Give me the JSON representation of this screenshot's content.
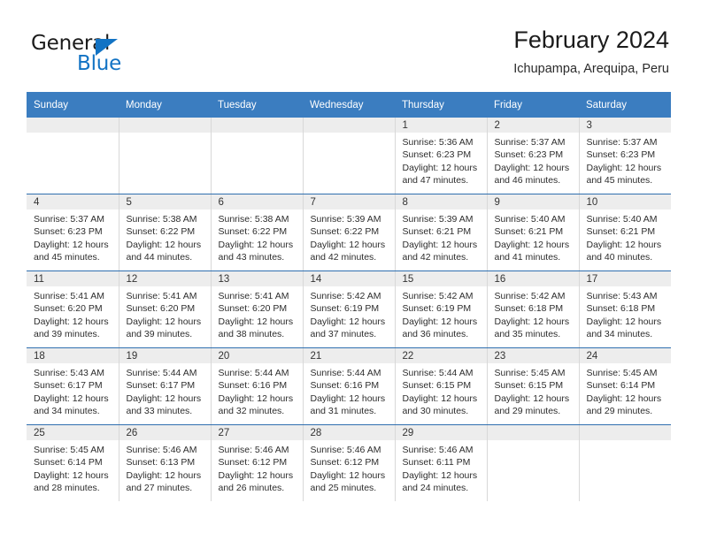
{
  "brand": {
    "name_top": "General",
    "name_bottom": "Blue",
    "accent_color": "#1273c4"
  },
  "header": {
    "title": "February 2024",
    "subtitle": "Ichupampa, Arequipa, Peru"
  },
  "calendar": {
    "header_bg": "#3b7dc0",
    "daynum_bg": "#ededed",
    "weekday_headers": [
      "Sunday",
      "Monday",
      "Tuesday",
      "Wednesday",
      "Thursday",
      "Friday",
      "Saturday"
    ],
    "labels": {
      "sunrise": "Sunrise:",
      "sunset": "Sunset:",
      "daylight": "Daylight:"
    },
    "weeks": [
      [
        {
          "day": "",
          "empty": true
        },
        {
          "day": "",
          "empty": true
        },
        {
          "day": "",
          "empty": true
        },
        {
          "day": "",
          "empty": true
        },
        {
          "day": "1",
          "sunrise": "Sunrise: 5:36 AM",
          "sunset": "Sunset: 6:23 PM",
          "daylight": "Daylight: 12 hours and 47 minutes."
        },
        {
          "day": "2",
          "sunrise": "Sunrise: 5:37 AM",
          "sunset": "Sunset: 6:23 PM",
          "daylight": "Daylight: 12 hours and 46 minutes."
        },
        {
          "day": "3",
          "sunrise": "Sunrise: 5:37 AM",
          "sunset": "Sunset: 6:23 PM",
          "daylight": "Daylight: 12 hours and 45 minutes."
        }
      ],
      [
        {
          "day": "4",
          "sunrise": "Sunrise: 5:37 AM",
          "sunset": "Sunset: 6:23 PM",
          "daylight": "Daylight: 12 hours and 45 minutes."
        },
        {
          "day": "5",
          "sunrise": "Sunrise: 5:38 AM",
          "sunset": "Sunset: 6:22 PM",
          "daylight": "Daylight: 12 hours and 44 minutes."
        },
        {
          "day": "6",
          "sunrise": "Sunrise: 5:38 AM",
          "sunset": "Sunset: 6:22 PM",
          "daylight": "Daylight: 12 hours and 43 minutes."
        },
        {
          "day": "7",
          "sunrise": "Sunrise: 5:39 AM",
          "sunset": "Sunset: 6:22 PM",
          "daylight": "Daylight: 12 hours and 42 minutes."
        },
        {
          "day": "8",
          "sunrise": "Sunrise: 5:39 AM",
          "sunset": "Sunset: 6:21 PM",
          "daylight": "Daylight: 12 hours and 42 minutes."
        },
        {
          "day": "9",
          "sunrise": "Sunrise: 5:40 AM",
          "sunset": "Sunset: 6:21 PM",
          "daylight": "Daylight: 12 hours and 41 minutes."
        },
        {
          "day": "10",
          "sunrise": "Sunrise: 5:40 AM",
          "sunset": "Sunset: 6:21 PM",
          "daylight": "Daylight: 12 hours and 40 minutes."
        }
      ],
      [
        {
          "day": "11",
          "sunrise": "Sunrise: 5:41 AM",
          "sunset": "Sunset: 6:20 PM",
          "daylight": "Daylight: 12 hours and 39 minutes."
        },
        {
          "day": "12",
          "sunrise": "Sunrise: 5:41 AM",
          "sunset": "Sunset: 6:20 PM",
          "daylight": "Daylight: 12 hours and 39 minutes."
        },
        {
          "day": "13",
          "sunrise": "Sunrise: 5:41 AM",
          "sunset": "Sunset: 6:20 PM",
          "daylight": "Daylight: 12 hours and 38 minutes."
        },
        {
          "day": "14",
          "sunrise": "Sunrise: 5:42 AM",
          "sunset": "Sunset: 6:19 PM",
          "daylight": "Daylight: 12 hours and 37 minutes."
        },
        {
          "day": "15",
          "sunrise": "Sunrise: 5:42 AM",
          "sunset": "Sunset: 6:19 PM",
          "daylight": "Daylight: 12 hours and 36 minutes."
        },
        {
          "day": "16",
          "sunrise": "Sunrise: 5:42 AM",
          "sunset": "Sunset: 6:18 PM",
          "daylight": "Daylight: 12 hours and 35 minutes."
        },
        {
          "day": "17",
          "sunrise": "Sunrise: 5:43 AM",
          "sunset": "Sunset: 6:18 PM",
          "daylight": "Daylight: 12 hours and 34 minutes."
        }
      ],
      [
        {
          "day": "18",
          "sunrise": "Sunrise: 5:43 AM",
          "sunset": "Sunset: 6:17 PM",
          "daylight": "Daylight: 12 hours and 34 minutes."
        },
        {
          "day": "19",
          "sunrise": "Sunrise: 5:44 AM",
          "sunset": "Sunset: 6:17 PM",
          "daylight": "Daylight: 12 hours and 33 minutes."
        },
        {
          "day": "20",
          "sunrise": "Sunrise: 5:44 AM",
          "sunset": "Sunset: 6:16 PM",
          "daylight": "Daylight: 12 hours and 32 minutes."
        },
        {
          "day": "21",
          "sunrise": "Sunrise: 5:44 AM",
          "sunset": "Sunset: 6:16 PM",
          "daylight": "Daylight: 12 hours and 31 minutes."
        },
        {
          "day": "22",
          "sunrise": "Sunrise: 5:44 AM",
          "sunset": "Sunset: 6:15 PM",
          "daylight": "Daylight: 12 hours and 30 minutes."
        },
        {
          "day": "23",
          "sunrise": "Sunrise: 5:45 AM",
          "sunset": "Sunset: 6:15 PM",
          "daylight": "Daylight: 12 hours and 29 minutes."
        },
        {
          "day": "24",
          "sunrise": "Sunrise: 5:45 AM",
          "sunset": "Sunset: 6:14 PM",
          "daylight": "Daylight: 12 hours and 29 minutes."
        }
      ],
      [
        {
          "day": "25",
          "sunrise": "Sunrise: 5:45 AM",
          "sunset": "Sunset: 6:14 PM",
          "daylight": "Daylight: 12 hours and 28 minutes."
        },
        {
          "day": "26",
          "sunrise": "Sunrise: 5:46 AM",
          "sunset": "Sunset: 6:13 PM",
          "daylight": "Daylight: 12 hours and 27 minutes."
        },
        {
          "day": "27",
          "sunrise": "Sunrise: 5:46 AM",
          "sunset": "Sunset: 6:12 PM",
          "daylight": "Daylight: 12 hours and 26 minutes."
        },
        {
          "day": "28",
          "sunrise": "Sunrise: 5:46 AM",
          "sunset": "Sunset: 6:12 PM",
          "daylight": "Daylight: 12 hours and 25 minutes."
        },
        {
          "day": "29",
          "sunrise": "Sunrise: 5:46 AM",
          "sunset": "Sunset: 6:11 PM",
          "daylight": "Daylight: 12 hours and 24 minutes."
        },
        {
          "day": "",
          "empty": true
        },
        {
          "day": "",
          "empty": true
        }
      ]
    ]
  }
}
